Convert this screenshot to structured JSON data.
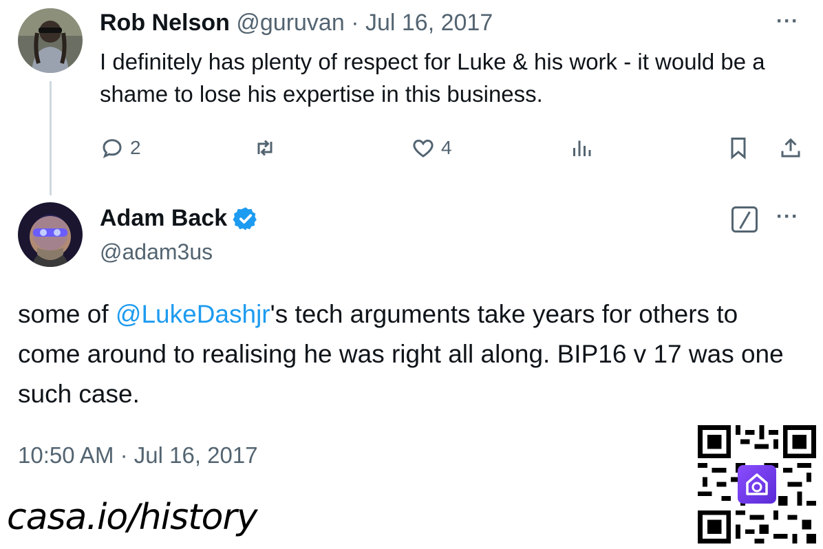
{
  "reply": {
    "author_name": "Rob Nelson",
    "handle": "@guruvan",
    "separator": "·",
    "date": "Jul 16, 2017",
    "text": "I definitely has plenty of respect for Luke & his work - it would be a shame to lose his expertise in this business.",
    "more_label": "···",
    "actions": {
      "reply_count": "2",
      "like_count": "4"
    }
  },
  "main_tweet": {
    "author_name": "Adam Back",
    "handle": "@adam3us",
    "more_label": "···",
    "text_before": "some of ",
    "mention": "@LukeDashjr",
    "text_after": "'s tech arguments take years for others to come around to realising he was right all along. BIP16 v 17 was one such case.",
    "timestamp": "10:50 AM · Jul 16, 2017"
  },
  "watermark": {
    "text": "casa.io/history"
  },
  "colors": {
    "text": "#0f1419",
    "muted": "#536471",
    "link": "#1d9bf0",
    "verified": "#1d9bf0",
    "thread_line": "#cfd9de"
  }
}
